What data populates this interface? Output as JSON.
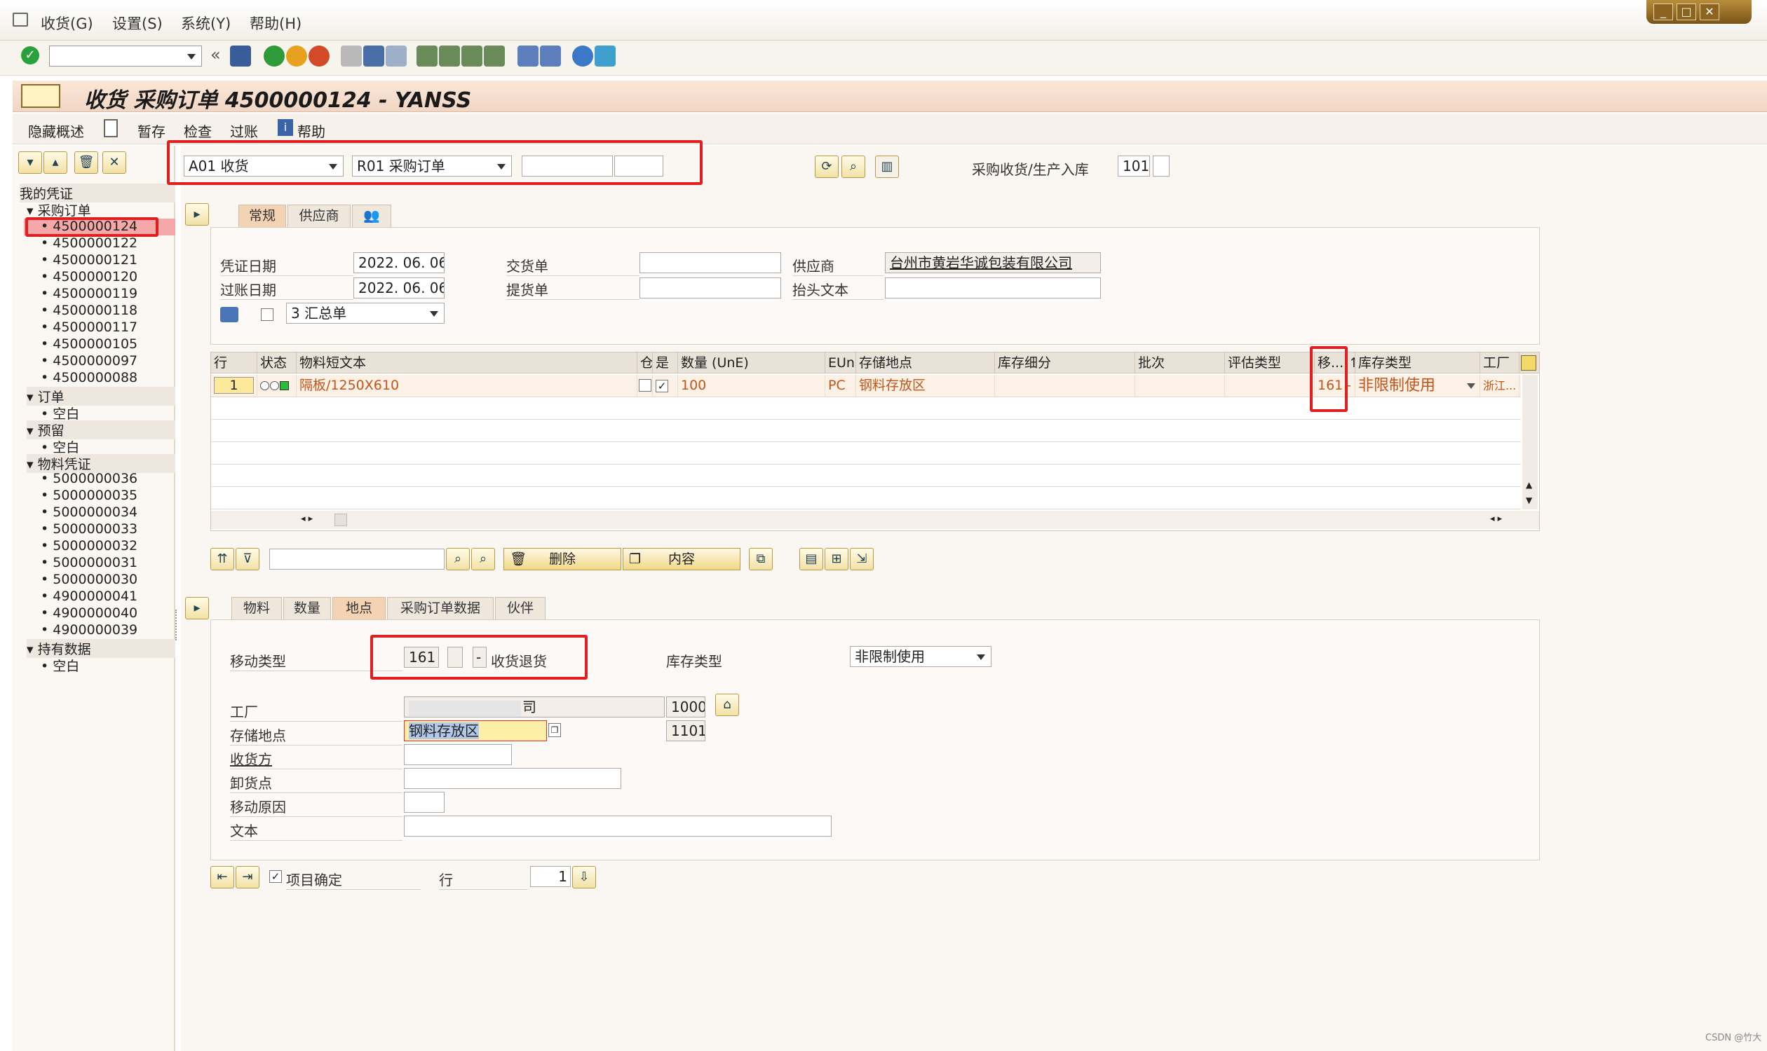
{
  "menu": [
    "收货(G)",
    "设置(S)",
    "系统(Y)",
    "帮助(H)"
  ],
  "title": "收货 采购订单 4500000124 - YANSS",
  "appbar": [
    "隐藏概述",
    "暂存",
    "检查",
    "过账",
    "帮助"
  ],
  "header": {
    "transaction": "A01 收货",
    "reference": "R01 采购订单",
    "po_number": "",
    "item": "",
    "movement_label": "采购收货/生产入库",
    "movement_type": "101"
  },
  "tree": {
    "root": "我的凭证",
    "groups": [
      {
        "label": "采购订单",
        "items": [
          "4500000124",
          "4500000122",
          "4500000121",
          "4500000120",
          "4500000119",
          "4500000118",
          "4500000117",
          "4500000105",
          "4500000097",
          "4500000088"
        ]
      },
      {
        "label": "订单",
        "items": [
          "空白"
        ]
      },
      {
        "label": "预留",
        "items": [
          "空白"
        ]
      },
      {
        "label": "物料凭证",
        "items": [
          "5000000036",
          "5000000035",
          "5000000034",
          "5000000033",
          "5000000032",
          "5000000031",
          "5000000030",
          "4900000041",
          "4900000040",
          "4900000039"
        ]
      },
      {
        "label": "持有数据",
        "items": [
          "空白"
        ]
      }
    ]
  },
  "header_tabs": [
    "常规",
    "供应商",
    "👥"
  ],
  "general": {
    "doc_date_label": "凭证日期",
    "doc_date": "2022. 06. 06",
    "post_date_label": "过账日期",
    "post_date": "2022. 06. 06",
    "delivery_note_label": "交货单",
    "delivery_note": "",
    "bill_of_lading_label": "提货单",
    "bill_of_lading": "",
    "vendor_label": "供应商",
    "vendor": "台州市黄岩华诚包装有限公司",
    "header_text_label": "抬头文本",
    "header_text": "",
    "slip": "3 汇总单"
  },
  "grid": {
    "columns": [
      "行",
      "状态",
      "物料短文本",
      "仓",
      "是",
      "数量 (UnE)",
      "EUn",
      "存储地点",
      "库存细分",
      "批次",
      "评估类型",
      "移...",
      "↑",
      "库存类型",
      "工厂"
    ],
    "rows": [
      {
        "line": "1",
        "status": "OOO",
        "material": "隔板/1250X610",
        "ok": "✓",
        "qty": "100",
        "unit": "PC",
        "sloc": "钢料存放区",
        "mvt": "161",
        "sign": "-",
        "stock_type": "非限制使用",
        "plant": "浙江..."
      }
    ]
  },
  "grid_buttons": {
    "delete": "删除",
    "content": "内容"
  },
  "detail_tabs": [
    "物料",
    "数量",
    "地点",
    "采购订单数据",
    "伙伴"
  ],
  "detail": {
    "mvt_label": "移动类型",
    "mvt_code": "161",
    "mvt_plus": "",
    "mvt_sign": "-",
    "mvt_text": "收货退货",
    "stock_type_label": "库存类型",
    "stock_type": "非限制使用",
    "plant_label": "工厂",
    "plant_name": "司",
    "plant_code": "1000",
    "sloc_label": "存储地点",
    "sloc_name": "钢料存放区",
    "sloc_code": "1101",
    "recipient_label": "收货方",
    "recipient": "",
    "unload_label": "卸货点",
    "unload": "",
    "reason_label": "移动原因",
    "reason": "",
    "text_label": "文本",
    "text": ""
  },
  "footer": {
    "item_ok_label": "项目确定",
    "line_label": "行",
    "line_value": "1"
  },
  "watermark": "CSDN @竹大"
}
